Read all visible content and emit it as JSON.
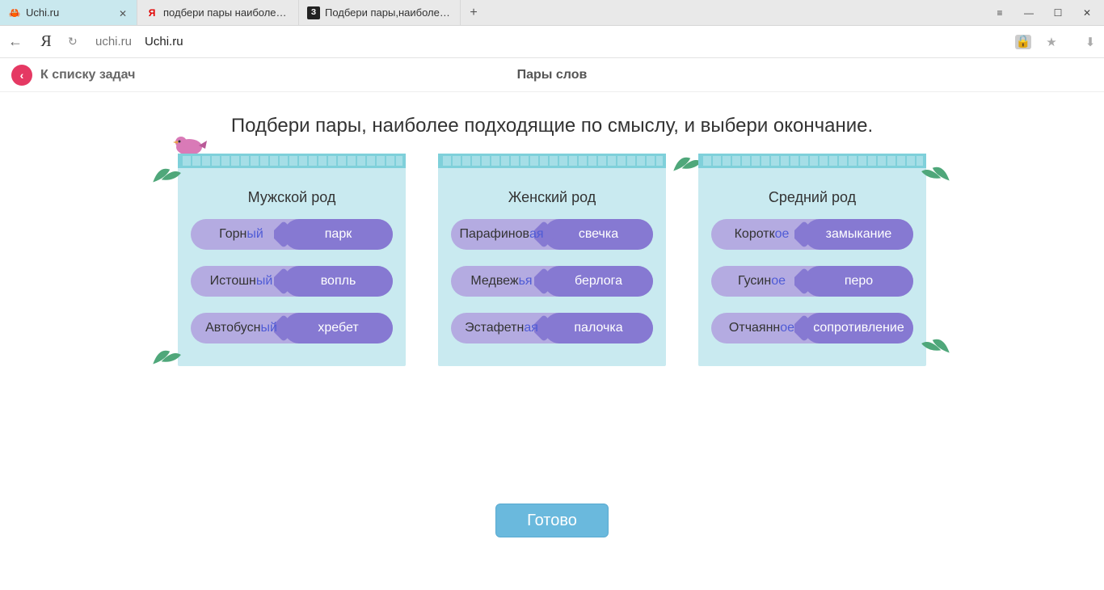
{
  "browser": {
    "tabs": [
      {
        "title": "Uchi.ru",
        "favicon": "🦀",
        "active": true
      },
      {
        "title": "подбери пары наиболее по",
        "favicon": "Я",
        "active": false
      },
      {
        "title": "Подбери пары,наиболее по",
        "favicon": "З",
        "active": false
      }
    ],
    "window_controls": {
      "menu": "≡",
      "minimize": "—",
      "maximize": "☐",
      "close": "✕"
    },
    "nav": {
      "back": "←"
    },
    "logo": "Я",
    "reload": "↻",
    "address_host": "uchi.ru",
    "address_display": "Uchi.ru",
    "icons": {
      "lock": "🔒",
      "star": "★",
      "download": "⬇"
    }
  },
  "page": {
    "back_label": "К списку задач",
    "title": "Пары слов",
    "instruction": "Подбери пары, наиболее подходящие по смыслу, и выбери окончание.",
    "done_label": "Готово",
    "columns": [
      {
        "title": "Мужской род",
        "pairs": [
          {
            "stem": "Горн",
            "ending": "ый",
            "noun": "парк"
          },
          {
            "stem": "Истошн",
            "ending": "ый",
            "noun": "вопль"
          },
          {
            "stem": "Автобусн",
            "ending": "ый",
            "noun": "хребет"
          }
        ]
      },
      {
        "title": "Женский род",
        "pairs": [
          {
            "stem": "Парафинов",
            "ending": "ая",
            "noun": "свечка"
          },
          {
            "stem": "Медвеж",
            "ending": "ья",
            "noun": "берлога"
          },
          {
            "stem": "Эстафетн",
            "ending": "ая",
            "noun": "палочка"
          }
        ]
      },
      {
        "title": "Средний род",
        "pairs": [
          {
            "stem": "Коротк",
            "ending": "ое",
            "noun": "замыкание"
          },
          {
            "stem": "Гусин",
            "ending": "ое",
            "noun": "перо"
          },
          {
            "stem": "Отчаянн",
            "ending": "ое",
            "noun": "сопротивление"
          }
        ]
      }
    ]
  }
}
